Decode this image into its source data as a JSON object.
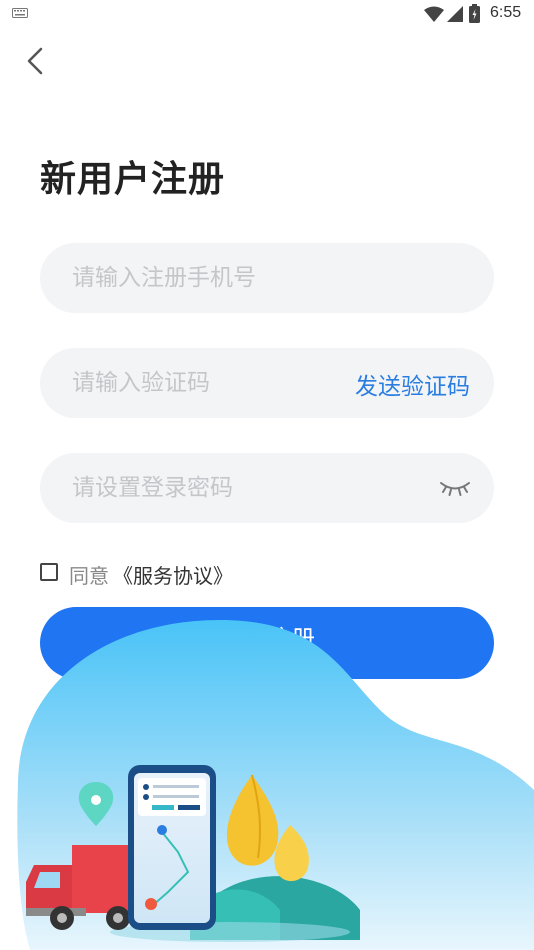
{
  "status_bar": {
    "time": "6:55"
  },
  "page": {
    "title": "新用户注册"
  },
  "form": {
    "phone_placeholder": "请输入注册手机号",
    "code_placeholder": "请输入验证码",
    "send_code_label": "发送验证码",
    "password_placeholder": "请设置登录密码"
  },
  "agreement": {
    "prefix": "同意",
    "link": "《服务协议》",
    "checked": false
  },
  "register_label": "立即注册",
  "colors": {
    "primary": "#2075f3",
    "link": "#2a7de1",
    "field_bg": "#f3f4f6"
  },
  "icons": [
    "keyboard-icon",
    "wifi-icon",
    "signal-icon",
    "battery-icon",
    "back-arrow-icon",
    "eye-closed-icon",
    "checkbox-icon"
  ]
}
